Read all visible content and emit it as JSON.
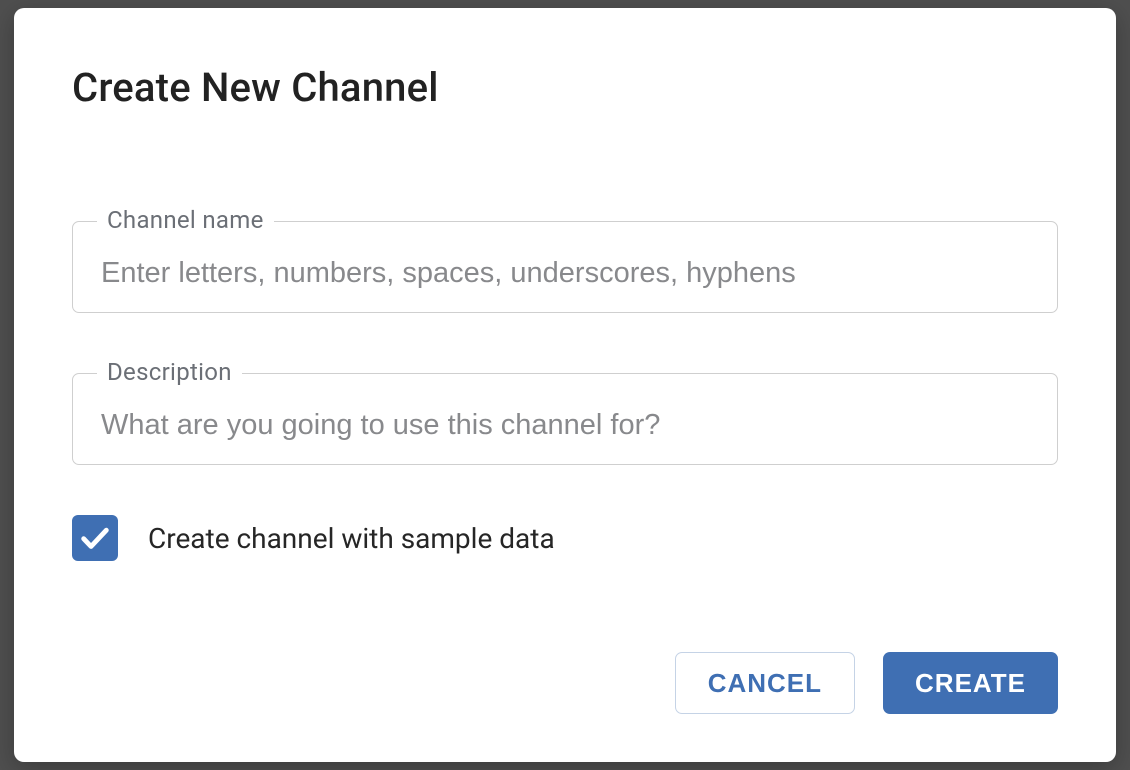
{
  "modal": {
    "title": "Create New Channel",
    "fields": {
      "channel_name": {
        "label": "Channel name",
        "placeholder": "Enter letters, numbers, spaces, underscores, hyphens",
        "value": ""
      },
      "description": {
        "label": "Description",
        "placeholder": "What are you going to use this channel for?",
        "value": ""
      }
    },
    "checkbox": {
      "label": "Create channel with sample data",
      "checked": true
    },
    "actions": {
      "cancel": "CANCEL",
      "create": "CREATE"
    }
  }
}
